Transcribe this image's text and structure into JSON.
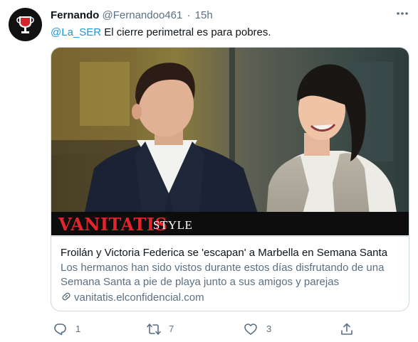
{
  "tweet": {
    "author_name": "Fernando",
    "author_handle": "@Fernandoo461",
    "separator": "·",
    "time": "15h",
    "mention": "@La_SER",
    "text": " El cierre perimetral es para pobres."
  },
  "card": {
    "brand": "VANITATIS",
    "brand_sub": "STYLE",
    "title": "Froilán y Victoria Federica se 'escapan' a Marbella en Semana Santa",
    "description": "Los hermanos han sido vistos durante estos días disfrutando de una Semana Santa a pie de playa junto a sus amigos y parejas",
    "domain": "vanitatis.elconfidencial.com",
    "domain_icon": "link-icon"
  },
  "actions": {
    "reply_count": "1",
    "retweet_count": "7",
    "like_count": "3",
    "reply_icon": "reply-icon",
    "retweet_icon": "retweet-icon",
    "like_icon": "heart-icon",
    "share_icon": "share-icon"
  },
  "colors": {
    "mention": "#1b95e0",
    "secondary_text": "#5b7083",
    "brand_red": "#e4242b",
    "border": "#cfd9de"
  }
}
